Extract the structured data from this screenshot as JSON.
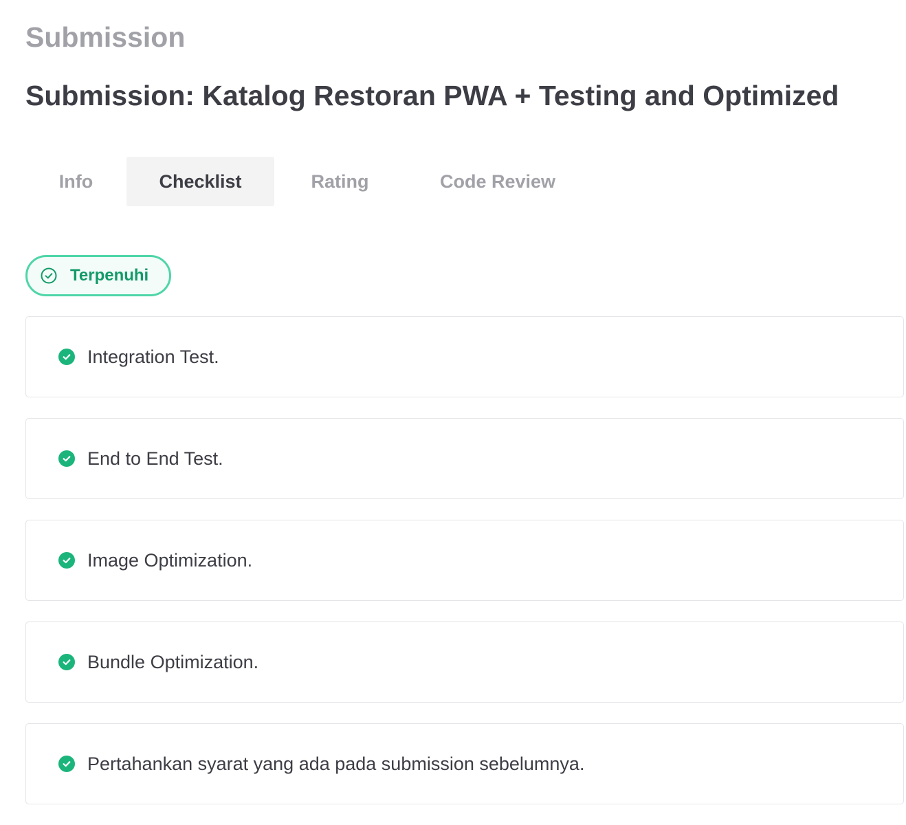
{
  "header": {
    "section_title": "Submission",
    "title": "Submission: Katalog Restoran PWA + Testing and Optimized"
  },
  "tabs": [
    {
      "label": "Info",
      "active": false
    },
    {
      "label": "Checklist",
      "active": true
    },
    {
      "label": "Rating",
      "active": false
    },
    {
      "label": "Code Review",
      "active": false
    }
  ],
  "status": {
    "label": "Terpenuhi",
    "icon": "check-circle-outline-icon",
    "color": "#139a68"
  },
  "checklist": {
    "items": [
      {
        "label": "Integration Test.",
        "icon": "check-circle-filled-icon"
      },
      {
        "label": "End to End Test.",
        "icon": "check-circle-filled-icon"
      },
      {
        "label": "Image Optimization.",
        "icon": "check-circle-filled-icon"
      },
      {
        "label": "Bundle Optimization.",
        "icon": "check-circle-filled-icon"
      },
      {
        "label": "Pertahankan syarat yang ada pada submission sebelumnya.",
        "icon": "check-circle-filled-icon"
      }
    ]
  },
  "colors": {
    "accent": "#1bb57c",
    "badge_border": "#4fd5a8",
    "muted_text": "#a1a1a8",
    "main_text": "#3d3d45"
  }
}
